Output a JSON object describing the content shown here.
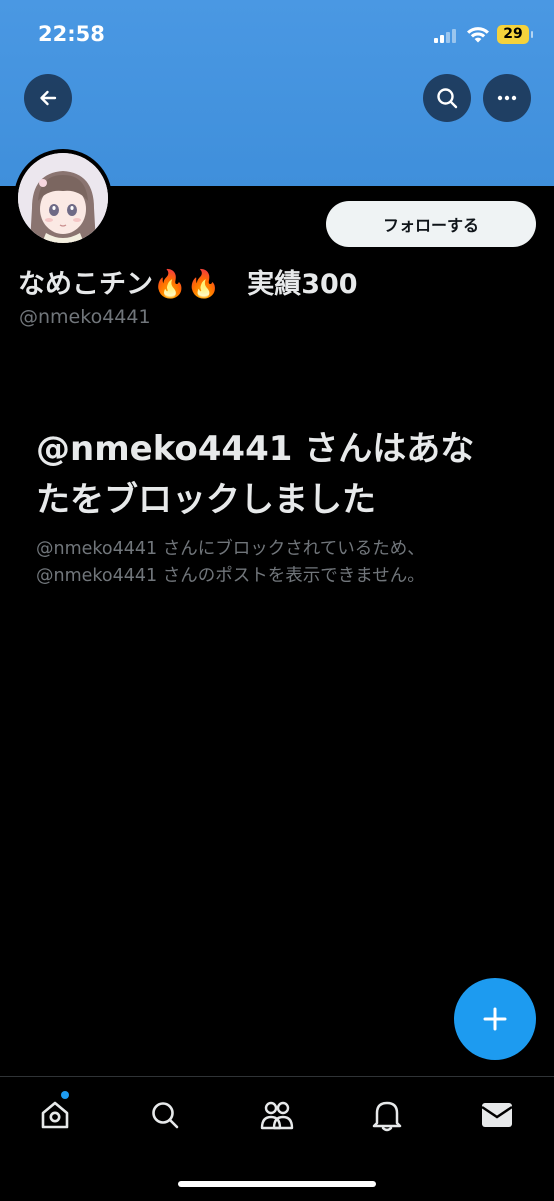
{
  "status_bar": {
    "time": "22:58",
    "battery": "29"
  },
  "header": {
    "back_icon": "arrow-left-icon",
    "search_icon": "search-icon",
    "more_icon": "more-horizontal-icon"
  },
  "profile": {
    "follow_label": "フォローする",
    "display_name": "なめこチン🔥🔥　実績300",
    "handle": "@nmeko4441"
  },
  "blocked": {
    "title": "@nmeko4441 さんはあなたをブロックしました",
    "description": "@nmeko4441 さんにブロックされているため、@nmeko4441 さんのポストを表示できません。"
  },
  "fab": {
    "icon": "plus-icon"
  },
  "tabbar": {
    "items": [
      {
        "icon": "home-icon"
      },
      {
        "icon": "search-icon"
      },
      {
        "icon": "communities-icon"
      },
      {
        "icon": "bell-icon"
      },
      {
        "icon": "mail-icon"
      }
    ]
  },
  "colors": {
    "banner": "#4a98e3",
    "background": "#000000",
    "accent": "#1d9bf0",
    "muted_text": "#71767b"
  }
}
